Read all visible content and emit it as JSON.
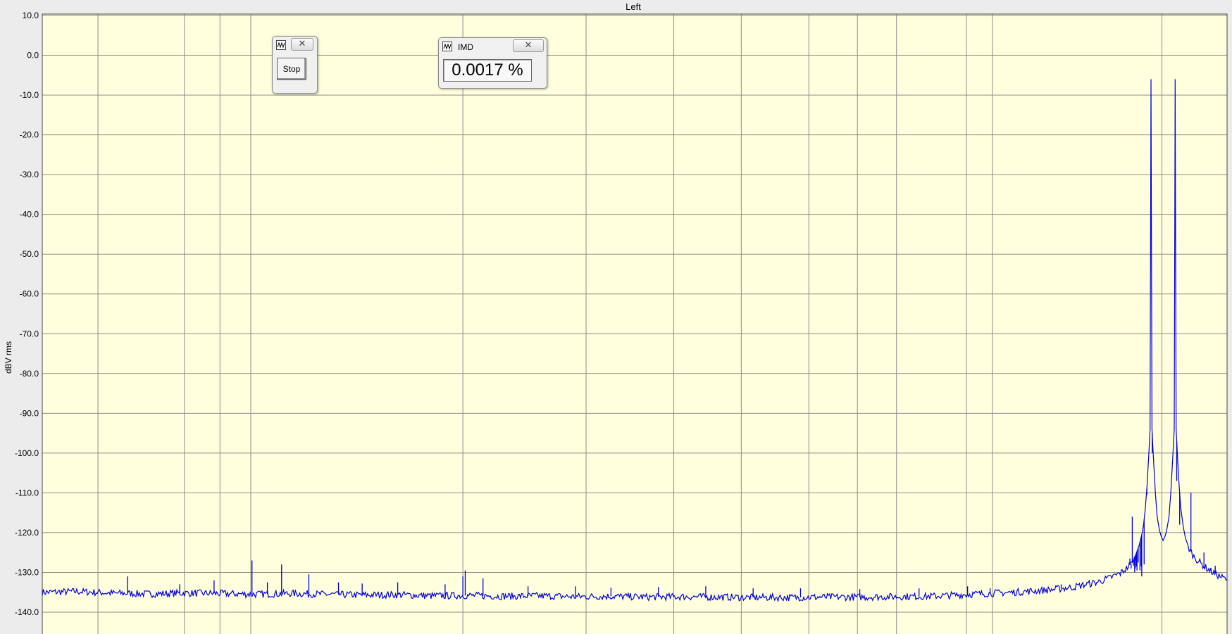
{
  "chart_data": {
    "type": "line",
    "title": "Left",
    "ylabel": "dBV rms",
    "xlabel": "",
    "ylim": [
      -145,
      10
    ],
    "x_domain": [
      0,
      1000
    ],
    "yticks": [
      10,
      0,
      -10,
      -20,
      -30,
      -40,
      -50,
      -60,
      -70,
      -80,
      -90,
      -100,
      -110,
      -120,
      -130,
      -140
    ],
    "ytick_labels": [
      "10.0",
      "0.0",
      "-10.0",
      "-20.0",
      "-30.0",
      "-40.0",
      "-50.0",
      "-60.0",
      "-70.0",
      "-80.0",
      "-90.0",
      "-100.0",
      "-110.0",
      "-120.0",
      "-130.0",
      "-140.0"
    ],
    "x_gridlines": [
      47,
      120,
      150,
      176,
      355,
      459,
      533,
      590,
      647,
      688,
      721,
      780,
      802,
      945
    ],
    "grid": true,
    "colors": {
      "plot_bg": "#ffffdd",
      "line": "#0000dd",
      "grid": "#8c8c8c"
    },
    "series": [
      {
        "points": [
          [
            0,
            -135
          ],
          [
            30,
            -134.8
          ],
          [
            60,
            -135.2
          ],
          [
            90,
            -135.4
          ],
          [
            120,
            -135.2
          ],
          [
            150,
            -135.3
          ],
          [
            180,
            -135.5
          ],
          [
            210,
            -135.3
          ],
          [
            240,
            -135.5
          ],
          [
            270,
            -135.7
          ],
          [
            300,
            -135.6
          ],
          [
            330,
            -135.9
          ],
          [
            360,
            -135.8
          ],
          [
            390,
            -136
          ],
          [
            420,
            -135.9
          ],
          [
            450,
            -136.1
          ],
          [
            480,
            -136
          ],
          [
            510,
            -136.2
          ],
          [
            540,
            -136.1
          ],
          [
            570,
            -136.2
          ],
          [
            600,
            -136.3
          ],
          [
            630,
            -136.3
          ],
          [
            660,
            -136.2
          ],
          [
            690,
            -136.2
          ],
          [
            720,
            -136.1
          ],
          [
            750,
            -136
          ],
          [
            770,
            -135.7
          ],
          [
            790,
            -135.4
          ],
          [
            820,
            -135
          ],
          [
            850,
            -134.4
          ],
          [
            870,
            -133.7
          ],
          [
            890,
            -132.5
          ],
          [
            900,
            -131.5
          ],
          [
            910,
            -130.2
          ],
          [
            915,
            -129
          ],
          [
            920,
            -127.5
          ],
          [
            923,
            -125.5
          ],
          [
            926,
            -123
          ],
          [
            928,
            -120.5
          ],
          [
            929.5,
            -118
          ],
          [
            931,
            -114
          ],
          [
            932.5,
            -108
          ],
          [
            934,
            -100
          ],
          [
            935,
            -94
          ],
          [
            935.8,
            -6
          ],
          [
            936.6,
            -94
          ],
          [
            938,
            -102
          ],
          [
            939.5,
            -110
          ],
          [
            941,
            -116
          ],
          [
            943,
            -119.5
          ],
          [
            944.5,
            -121
          ],
          [
            946,
            -122
          ],
          [
            947.5,
            -121
          ],
          [
            949,
            -119.5
          ],
          [
            951,
            -116
          ],
          [
            952.5,
            -110
          ],
          [
            954,
            -102
          ],
          [
            955.4,
            -94
          ],
          [
            956.2,
            -6
          ],
          [
            957,
            -94
          ],
          [
            958,
            -100
          ],
          [
            959.5,
            -108
          ],
          [
            961,
            -114
          ],
          [
            963,
            -118.5
          ],
          [
            965,
            -121.5
          ],
          [
            968,
            -124
          ],
          [
            972,
            -126
          ],
          [
            977,
            -127.5
          ],
          [
            982,
            -128.8
          ],
          [
            988,
            -130
          ],
          [
            994,
            -131
          ],
          [
            1000,
            -131.8
          ]
        ],
        "spurs": [
          [
            72,
            -131
          ],
          [
            116,
            -133
          ],
          [
            177,
            -127
          ],
          [
            202,
            -128
          ],
          [
            225,
            -130.5
          ],
          [
            355,
            -131
          ],
          [
            357,
            -129.5
          ],
          [
            372,
            -131.5
          ],
          [
            781,
            -133.5
          ],
          [
            918,
            -126.5
          ],
          [
            920,
            -116
          ],
          [
            925,
            -127.5
          ],
          [
            922,
            -128
          ],
          [
            922.5,
            -129
          ],
          [
            927.5,
            -128.5
          ],
          [
            922,
            -130
          ],
          [
            924,
            -129.5
          ],
          [
            923.5,
            -128.5
          ],
          [
            922.8,
            -127
          ],
          [
            919,
            -129
          ],
          [
            921,
            -128.3
          ],
          [
            926.5,
            -129.5
          ],
          [
            928,
            -131
          ],
          [
            1000,
            -132
          ],
          [
            930,
            -128
          ],
          [
            932.3,
            -110.5
          ],
          [
            936.8,
            -100
          ],
          [
            957.5,
            -107
          ],
          [
            960,
            -118
          ],
          [
            969.5,
            -110
          ],
          [
            980.5,
            -125
          ],
          [
            990,
            -128.3
          ],
          [
            145,
            -132
          ],
          [
            190,
            -132.5
          ],
          [
            250,
            -132.5
          ],
          [
            270,
            -132.8
          ],
          [
            300,
            -132.5
          ],
          [
            340,
            -133
          ],
          [
            410,
            -133.5
          ],
          [
            450,
            -133.5
          ],
          [
            480,
            -133.8
          ],
          [
            520,
            -133.7
          ],
          [
            560,
            -133.5
          ],
          [
            600,
            -134
          ],
          [
            640,
            -134
          ],
          [
            690,
            -134.2
          ],
          [
            740,
            -134
          ],
          [
            800,
            -134
          ],
          [
            860,
            -133
          ]
        ]
      }
    ]
  },
  "controls": {
    "stop_window": {
      "close_glyph": "✕",
      "button_label": "Stop"
    },
    "imd_window": {
      "title": "IMD",
      "close_glyph": "✕",
      "value": "0.0017 %"
    }
  }
}
